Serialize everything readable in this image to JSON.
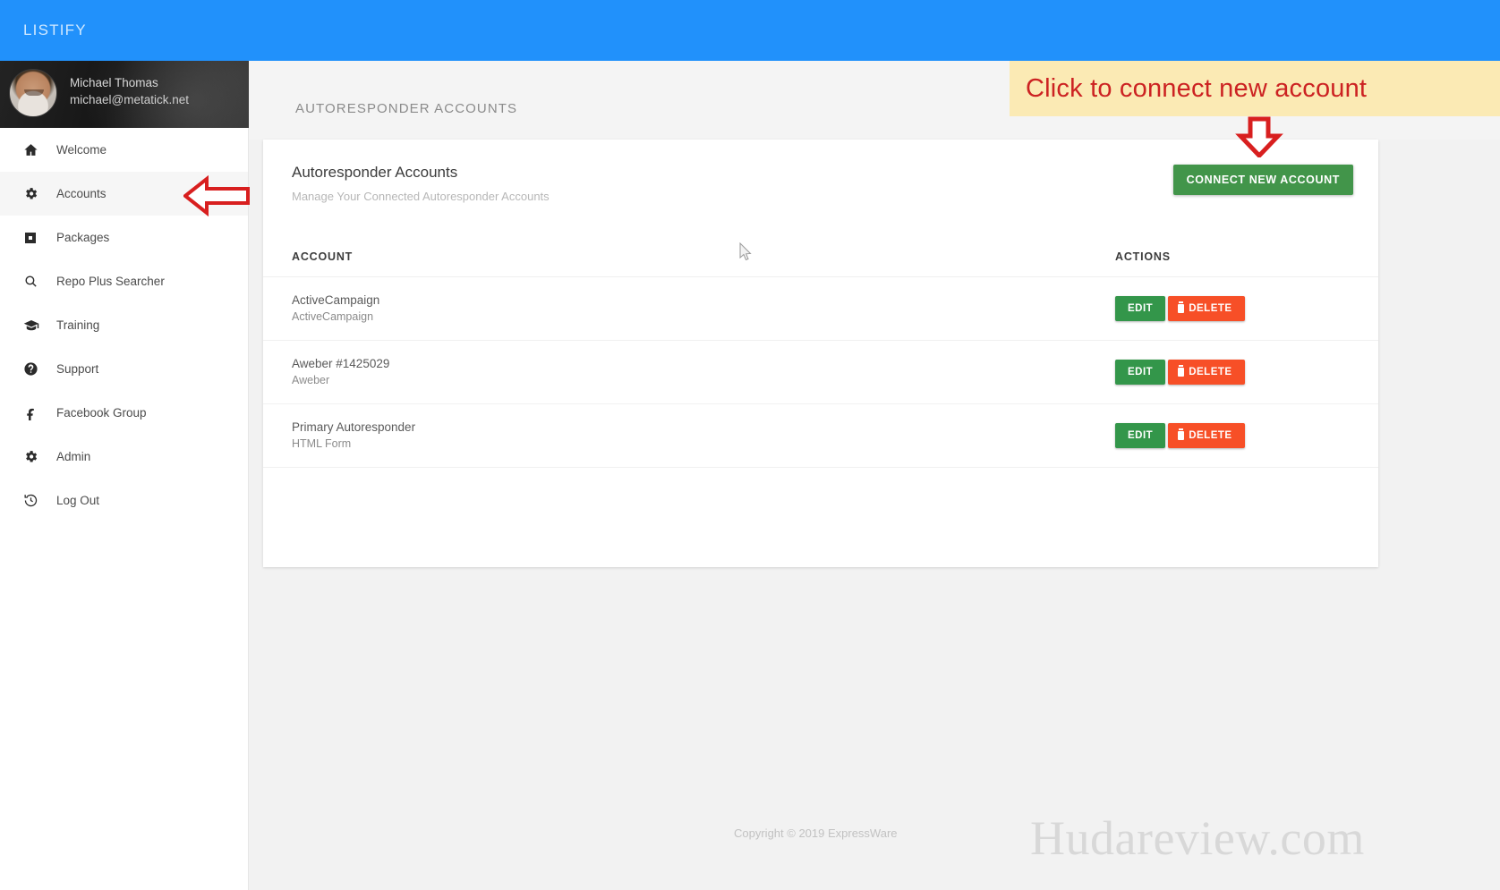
{
  "topbar": {
    "brand": "LISTIFY"
  },
  "profile": {
    "name": "Michael Thomas",
    "email": "michael@metatick.net",
    "avatar_icon": "user-avatar-photo"
  },
  "sidebar": {
    "items": [
      {
        "label": "Welcome",
        "icon": "home-icon",
        "active": false
      },
      {
        "label": "Accounts",
        "icon": "gear-icon",
        "active": true
      },
      {
        "label": "Packages",
        "icon": "package-box-icon",
        "active": false
      },
      {
        "label": "Repo Plus Searcher",
        "icon": "search-icon",
        "active": false
      },
      {
        "label": "Training",
        "icon": "graduation-cap-icon",
        "active": false
      },
      {
        "label": "Support",
        "icon": "question-circle-icon",
        "active": false
      },
      {
        "label": "Facebook Group",
        "icon": "facebook-icon",
        "active": false
      },
      {
        "label": "Admin",
        "icon": "gear-icon",
        "active": false
      },
      {
        "label": "Log Out",
        "icon": "history-clock-icon",
        "active": false
      }
    ]
  },
  "page": {
    "header_title": "AUTORESPONDER ACCOUNTS",
    "card_title": "Autoresponder Accounts",
    "card_subtitle": "Manage Your Connected Autoresponder Accounts",
    "connect_button": "CONNECT NEW ACCOUNT"
  },
  "table": {
    "columns": {
      "account": "ACCOUNT",
      "actions": "ACTIONS"
    },
    "rows": [
      {
        "name": "ActiveCampaign",
        "type": "ActiveCampaign",
        "edit": "EDIT",
        "delete": "DELETE"
      },
      {
        "name": "Aweber #1425029",
        "type": "Aweber",
        "edit": "EDIT",
        "delete": "DELETE"
      },
      {
        "name": "Primary Autoresponder",
        "type": "HTML Form",
        "edit": "EDIT",
        "delete": "DELETE"
      }
    ]
  },
  "footer": {
    "copyright": "Copyright © 2019 ExpressWare",
    "watermark": "Hudareview.com"
  },
  "annotations": {
    "banner_text": "Click to connect new account",
    "down_arrow_icon": "red-down-arrow",
    "left_arrow_icon": "red-left-arrow"
  },
  "colors": {
    "topbar_blue": "#2191fb",
    "connect_green": "#42954a",
    "edit_green": "#33964a",
    "delete_red": "#f74f27",
    "annotation_yellow": "#fbeab4",
    "annotation_red": "#cc2222"
  },
  "cursor": {
    "icon": "mouse-pointer-icon"
  }
}
